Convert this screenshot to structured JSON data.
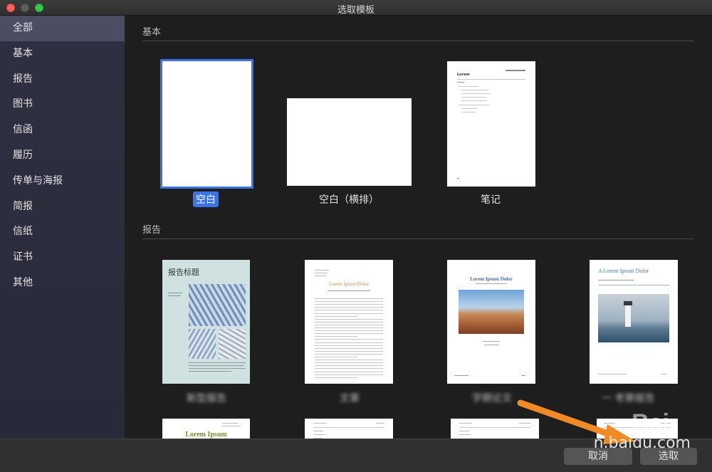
{
  "window": {
    "title": "选取模板"
  },
  "sidebar": {
    "items": [
      {
        "label": "全部",
        "active": true
      },
      {
        "label": "基本"
      },
      {
        "label": "报告"
      },
      {
        "label": "图书"
      },
      {
        "label": "信函"
      },
      {
        "label": "履历"
      },
      {
        "label": "传单与海报"
      },
      {
        "label": "简报"
      },
      {
        "label": "信纸"
      },
      {
        "label": "证书"
      },
      {
        "label": "其他"
      }
    ]
  },
  "sections": {
    "basic": {
      "title": "基本",
      "templates": [
        {
          "label": "空白",
          "selected": true
        },
        {
          "label": "空白（横排）"
        },
        {
          "label": "笔记"
        }
      ]
    },
    "report": {
      "title": "报告",
      "templates": [
        {
          "label": "新型报告",
          "cover_title": "报告标题"
        },
        {
          "label": "文章",
          "cover_title": "Lorem Ipsum Dolor"
        },
        {
          "label": "学期论文",
          "cover_title": "Lorem Ipsum Dolor"
        },
        {
          "label": "一 考察报告",
          "cover_title": "A Lorem Ipsum Dolor"
        }
      ]
    },
    "row3": {
      "templates": [
        {
          "cover_title": "Lorem Ipsum"
        },
        {},
        {},
        {}
      ]
    }
  },
  "notes_template": {
    "title": "Lorem"
  },
  "footer": {
    "cancel_label": "取消",
    "choose_label": "选取"
  },
  "watermark": {
    "text": "n.baidu.com",
    "logo": "Bai"
  },
  "colors": {
    "accent": "#3c73e6",
    "sidebar": "#2b2d3e",
    "arrow": "#f08a24"
  }
}
